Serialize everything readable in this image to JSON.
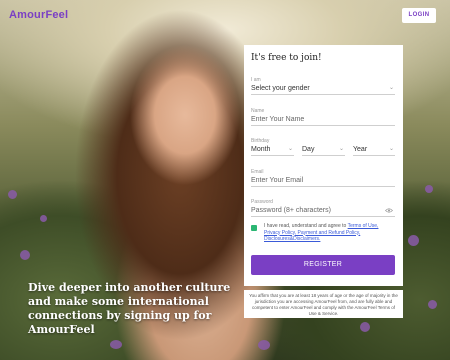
{
  "header": {
    "brand": "AmourFeel",
    "login_label": "LOGIN"
  },
  "hero": {
    "tagline": "Dive deeper into another culture and make some international connections by signing up for AmourFeel"
  },
  "form": {
    "title": "It's free to join!",
    "gender": {
      "label": "I am",
      "value": "Select your gender"
    },
    "name": {
      "label": "Name",
      "placeholder": "Enter Your Name"
    },
    "birthday": {
      "label": "Birthday",
      "month": "Month",
      "day": "Day",
      "year": "Year"
    },
    "email": {
      "label": "Email",
      "placeholder": "Enter Your Email"
    },
    "password": {
      "label": "Password",
      "placeholder": "Password (8+ characters)"
    },
    "consent": {
      "prefix": "I have read, understand and agree to",
      "terms_link": "Terms of Use,",
      "privacy_link": "Privacy Policy, Payment and Refund Policy,",
      "disclosures_link": "Disclosures&Disclaimers."
    },
    "register_label": "REGISTER"
  },
  "legal": {
    "text": "You affirm that you are at least 18 years of age or the age of majority in the jurisdiction you are accessing AmourFeel from, and are fully able and competent to enter AmourFeel and comply with the AmourFeel Terms of Use & Service."
  },
  "colors": {
    "accent": "#7a3fc4",
    "checkbox": "#2bb673",
    "link": "#3a5ad8"
  }
}
